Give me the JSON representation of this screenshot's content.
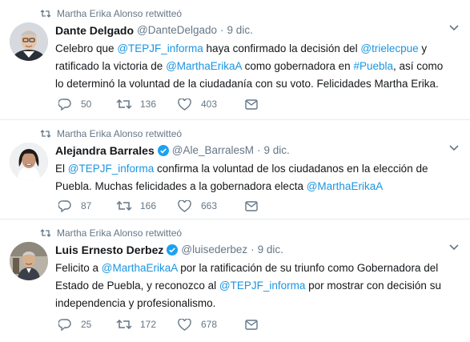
{
  "tweets": [
    {
      "retweet_context": "Martha Erika Alonso retwitteó",
      "author": {
        "name": "Dante Delgado",
        "handle": "@DanteDelgado",
        "verified": false,
        "avatar": "avatar-dante"
      },
      "time": "9 dic.",
      "dot": "·",
      "text_lines": [
        [
          {
            "t": "Celebro que "
          },
          {
            "t": "@TEPJF_informa",
            "link": true
          },
          {
            "t": " haya confirmado la decisión del "
          },
          {
            "t": "@trielecpue",
            "link": true
          },
          {
            "t": " y"
          }
        ],
        [
          {
            "t": "ratificado la victoria de "
          },
          {
            "t": "@MarthaErikaA",
            "link": true
          },
          {
            "t": " como gobernadora en "
          },
          {
            "t": "#Puebla",
            "link": true
          },
          {
            "t": ", así como"
          }
        ],
        [
          {
            "t": "lo determinó la voluntad de la ciudadanía con su voto. Felicidades Martha Erika."
          }
        ]
      ],
      "replies": "50",
      "retweets": "136",
      "likes": "403"
    },
    {
      "retweet_context": "Martha Erika Alonso retwitteó",
      "author": {
        "name": "Alejandra Barrales",
        "handle": "@Ale_BarralesM",
        "verified": true,
        "avatar": "avatar-alejandra"
      },
      "time": "9 dic.",
      "dot": "·",
      "text_lines": [
        [
          {
            "t": "El "
          },
          {
            "t": "@TEPJF_informa",
            "link": true
          },
          {
            "t": " confirma la voluntad de los ciudadanos en la elección de"
          }
        ],
        [
          {
            "t": "Puebla. Muchas felicidades a la gobernadora electa "
          },
          {
            "t": "@MarthaErikaA",
            "link": true
          }
        ]
      ],
      "replies": "87",
      "retweets": "166",
      "likes": "663"
    },
    {
      "retweet_context": "Martha Erika Alonso retwitteó",
      "author": {
        "name": "Luis Ernesto Derbez",
        "handle": "@luisederbez",
        "verified": true,
        "avatar": "avatar-luis"
      },
      "time": "9 dic.",
      "dot": "·",
      "text_lines": [
        [
          {
            "t": "Felicito a "
          },
          {
            "t": "@MarthaErikaA",
            "link": true
          },
          {
            "t": " por la ratificación de su triunfo como Gobernadora del"
          }
        ],
        [
          {
            "t": "Estado de Puebla, y reconozco al "
          },
          {
            "t": "@TEPJF_informa",
            "link": true
          },
          {
            "t": " por mostrar con decisión su"
          }
        ],
        [
          {
            "t": "independencia y profesionalismo."
          }
        ]
      ],
      "replies": "25",
      "retweets": "172",
      "likes": "678"
    }
  ],
  "colors": {
    "link": "#1b95e0",
    "secondary": "#657786",
    "verified": "#1da1f2",
    "border": "#e6ecf0"
  },
  "icons": [
    "retweet-icon",
    "verified-badge-icon",
    "caret-down-icon",
    "reply-icon",
    "like-icon",
    "direct-message-icon"
  ]
}
